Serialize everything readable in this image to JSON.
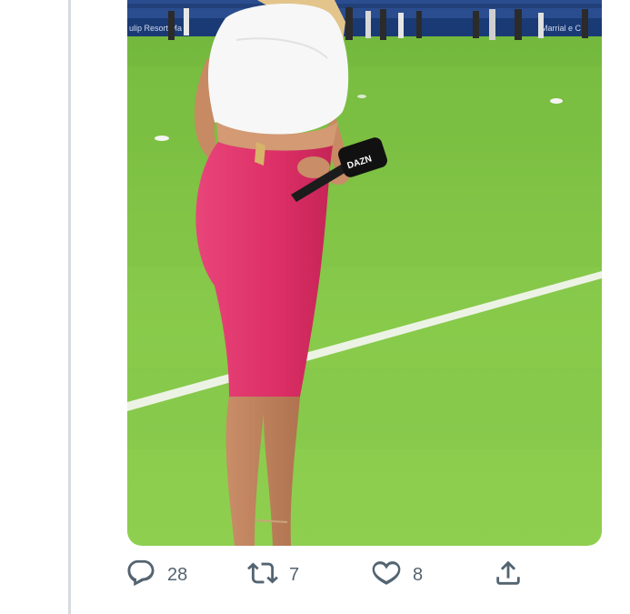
{
  "tweet": {
    "media": {
      "banner_text_left": "ulip Resort Ma",
      "banner_text_right": "Marrial e C",
      "mic_flag_text": "DAZN"
    },
    "actions": {
      "reply_count": "28",
      "retweet_count": "7",
      "like_count": "8"
    }
  },
  "icons": {
    "reply": "reply-bubble-icon",
    "retweet": "retweet-icon",
    "like": "heart-icon",
    "share": "share-upload-icon"
  },
  "colors": {
    "icon_gray": "#536471",
    "thread_line": "#d6dbe0",
    "pitch_green": "#7fc243",
    "skirt_pink": "#e23a6e"
  }
}
